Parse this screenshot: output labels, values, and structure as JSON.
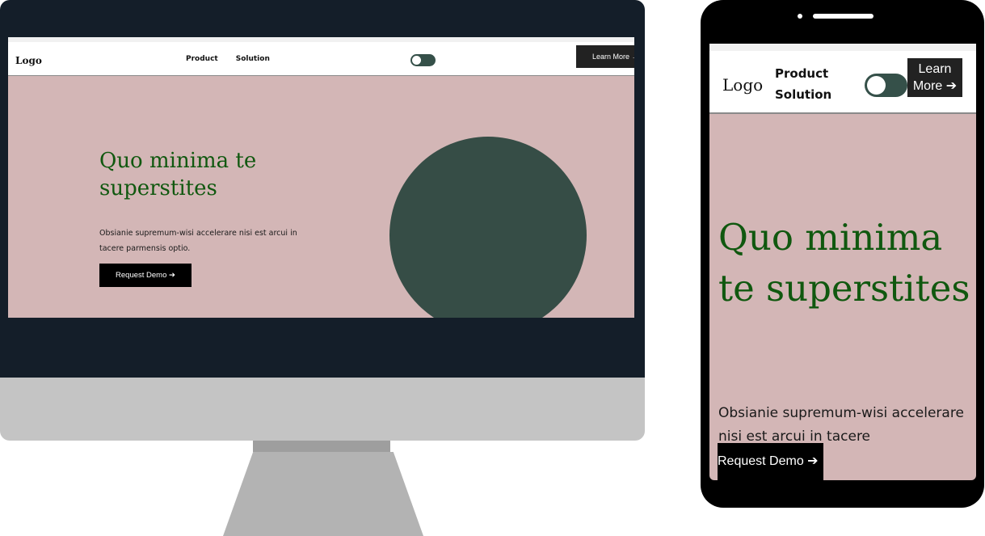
{
  "colors": {
    "hero_background": "#d3b6b6",
    "heading_green": "#10580f",
    "circle": "#364d46",
    "toggle": "#355049",
    "button_dark": "#000000",
    "monitor_frame": "#141e29"
  },
  "desktop": {
    "nav": {
      "logo": "Logo",
      "links": [
        "Product",
        "Solution"
      ],
      "cta": "Learn More →"
    },
    "hero": {
      "title": "Quo minima te superstites",
      "text": "Obsianie supremum-wisi accelerare nisi est arcui in tacere parmensis optio.",
      "button": "Request Demo ➔"
    }
  },
  "mobile": {
    "nav": {
      "logo": "Logo",
      "links": [
        "Product",
        "Solution"
      ],
      "cta": "Learn More ➔"
    },
    "hero": {
      "title": "Quo minima te superstites",
      "text": "Obsianie supremum-wisi accelerare nisi est arcui in tacere",
      "button": "Request Demo ➔"
    }
  }
}
